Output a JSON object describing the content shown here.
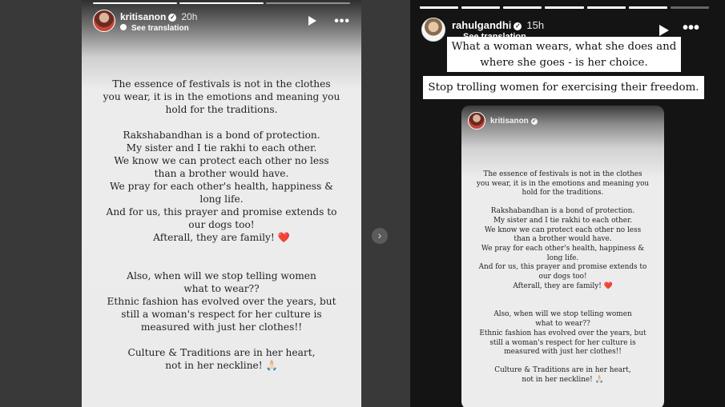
{
  "left_story": {
    "username": "kritisanon",
    "time": "20h",
    "translate": "See translation",
    "paragraphs": [
      [
        "The essence of festivals is not in the clothes",
        "you wear, it is in the emotions and meaning you",
        "hold for the traditions."
      ],
      [
        "Rakshabandhan is a bond of protection.",
        "My sister and I tie rakhi to each other.",
        "We know we can protect each other no less",
        "than a brother would have.",
        "We pray for each other's health, happiness &",
        "long life.",
        "And for us, this prayer and promise extends to",
        "our dogs too!",
        "Afterall, they are family! ❤️"
      ],
      [
        "Also, when will we stop telling women",
        "what to wear??",
        "Ethnic fashion has evolved over the years, but",
        "still a woman's respect for her culture is",
        "measured with just her clothes!!"
      ],
      [
        "Culture & Traditions are in her heart,",
        "not in her neckline! 🙏🏻"
      ]
    ]
  },
  "right_story": {
    "username": "rahulgandhi",
    "time": "15h",
    "translate": "See translation",
    "caption_1": "What a woman wears, what she does and where she goes - is her choice.",
    "caption_2": "Stop trolling women for exercising their freedom.",
    "shared_card": {
      "username": "kritisanon"
    }
  },
  "icons": {
    "play": "play-icon",
    "more": "more-options-icon",
    "next": "chevron-right-icon",
    "verified": "verified-badge-icon"
  }
}
